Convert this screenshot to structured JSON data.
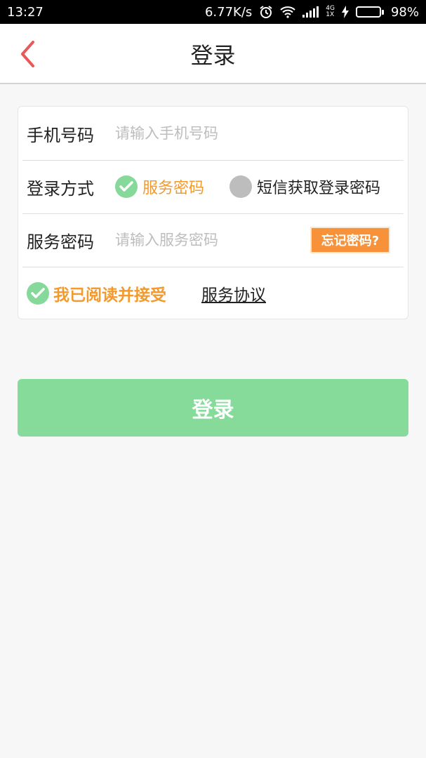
{
  "status_bar": {
    "time": "13:27",
    "net_speed": "6.77K/s",
    "network_type_top": "4G",
    "network_type_bottom": "1X",
    "battery_percent_text": "98%",
    "battery_level": 0.98,
    "icons": [
      "alarm-icon",
      "wifi-icon",
      "signal-icon",
      "charging-icon",
      "battery-icon"
    ]
  },
  "header": {
    "title": "登录",
    "back_icon": "chevron-left-icon"
  },
  "form": {
    "phone": {
      "label": "手机号码",
      "placeholder": "请输入手机号码",
      "value": ""
    },
    "login_method": {
      "label": "登录方式",
      "options": [
        {
          "label": "服务密码",
          "selected": true
        },
        {
          "label": "短信获取登录密码",
          "selected": false
        }
      ]
    },
    "password": {
      "label": "服务密码",
      "placeholder": "请输入服务密码",
      "value": "",
      "forgot_label": "忘记密码?"
    },
    "agreement": {
      "checked": true,
      "text": "我已阅读并接受",
      "link_text": "服务协议"
    }
  },
  "login_button": {
    "label": "登录"
  },
  "colors": {
    "accent_orange": "#f29a2e",
    "forgot_bg": "#f7923b",
    "green": "#86db9b",
    "back_red": "#e8595a"
  }
}
